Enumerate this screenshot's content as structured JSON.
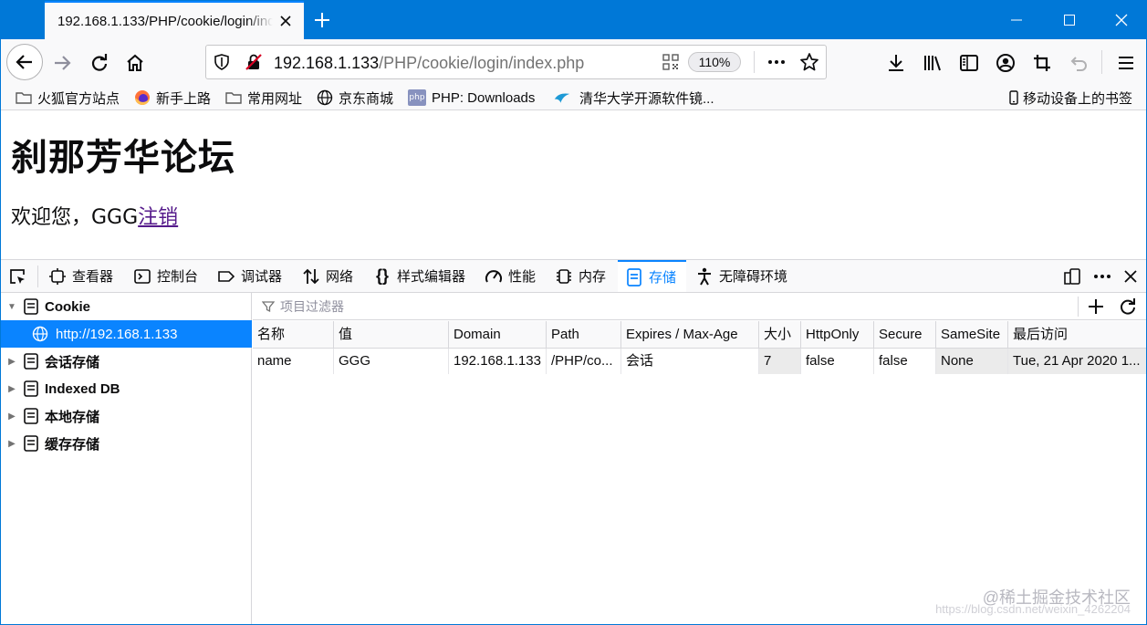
{
  "tab": {
    "title": "192.168.1.133/PHP/cookie/login/index.php"
  },
  "url": {
    "host": "192.168.1.133",
    "path": "/PHP/cookie/login/index.php",
    "zoom": "110%"
  },
  "bookmarks": [
    {
      "label": "火狐官方站点",
      "icon": "folder-icon"
    },
    {
      "label": "新手上路",
      "icon": "firefox-icon"
    },
    {
      "label": "常用网址",
      "icon": "folder-icon"
    },
    {
      "label": "京东商城",
      "icon": "globe-icon"
    },
    {
      "label": "PHP: Downloads",
      "icon": "php-icon",
      "icon_text": "php"
    },
    {
      "label": "清华大学开源软件镜...",
      "icon": "tuna-icon"
    }
  ],
  "mobile_bookmarks": "移动设备上的书签",
  "page": {
    "heading": "刹那芳华论坛",
    "welcome": "欢迎您，GGG",
    "logout": "注销"
  },
  "devtools": {
    "tabs": [
      {
        "label": "查看器",
        "icon": "inspector-icon"
      },
      {
        "label": "控制台",
        "icon": "console-icon"
      },
      {
        "label": "调试器",
        "icon": "debugger-icon"
      },
      {
        "label": "网络",
        "icon": "network-icon"
      },
      {
        "label": "样式编辑器",
        "icon": "style-editor-icon"
      },
      {
        "label": "性能",
        "icon": "performance-icon"
      },
      {
        "label": "内存",
        "icon": "memory-icon"
      },
      {
        "label": "存储",
        "icon": "storage-icon"
      },
      {
        "label": "无障碍环境",
        "icon": "accessibility-icon"
      }
    ],
    "active_tab": "存储",
    "tree": [
      {
        "label": "Cookie",
        "expanded": true
      },
      {
        "label": "http://192.168.1.133",
        "selected": true
      },
      {
        "label": "会话存储"
      },
      {
        "label": "Indexed DB"
      },
      {
        "label": "本地存储"
      },
      {
        "label": "缓存存储"
      }
    ],
    "filter_placeholder": "项目过滤器",
    "columns": [
      "名称",
      "值",
      "Domain",
      "Path",
      "Expires / Max-Age",
      "大小",
      "HttpOnly",
      "Secure",
      "SameSite",
      "最后访问"
    ],
    "rows": [
      [
        "name",
        "GGG",
        "192.168.1.133",
        "/PHP/co...",
        "会话",
        "7",
        "false",
        "false",
        "None",
        "Tue, 21 Apr 2020 1..."
      ]
    ]
  },
  "watermark": {
    "text": "@稀土掘金技术社区",
    "url": "https://blog.csdn.net/weixin_4262204"
  }
}
